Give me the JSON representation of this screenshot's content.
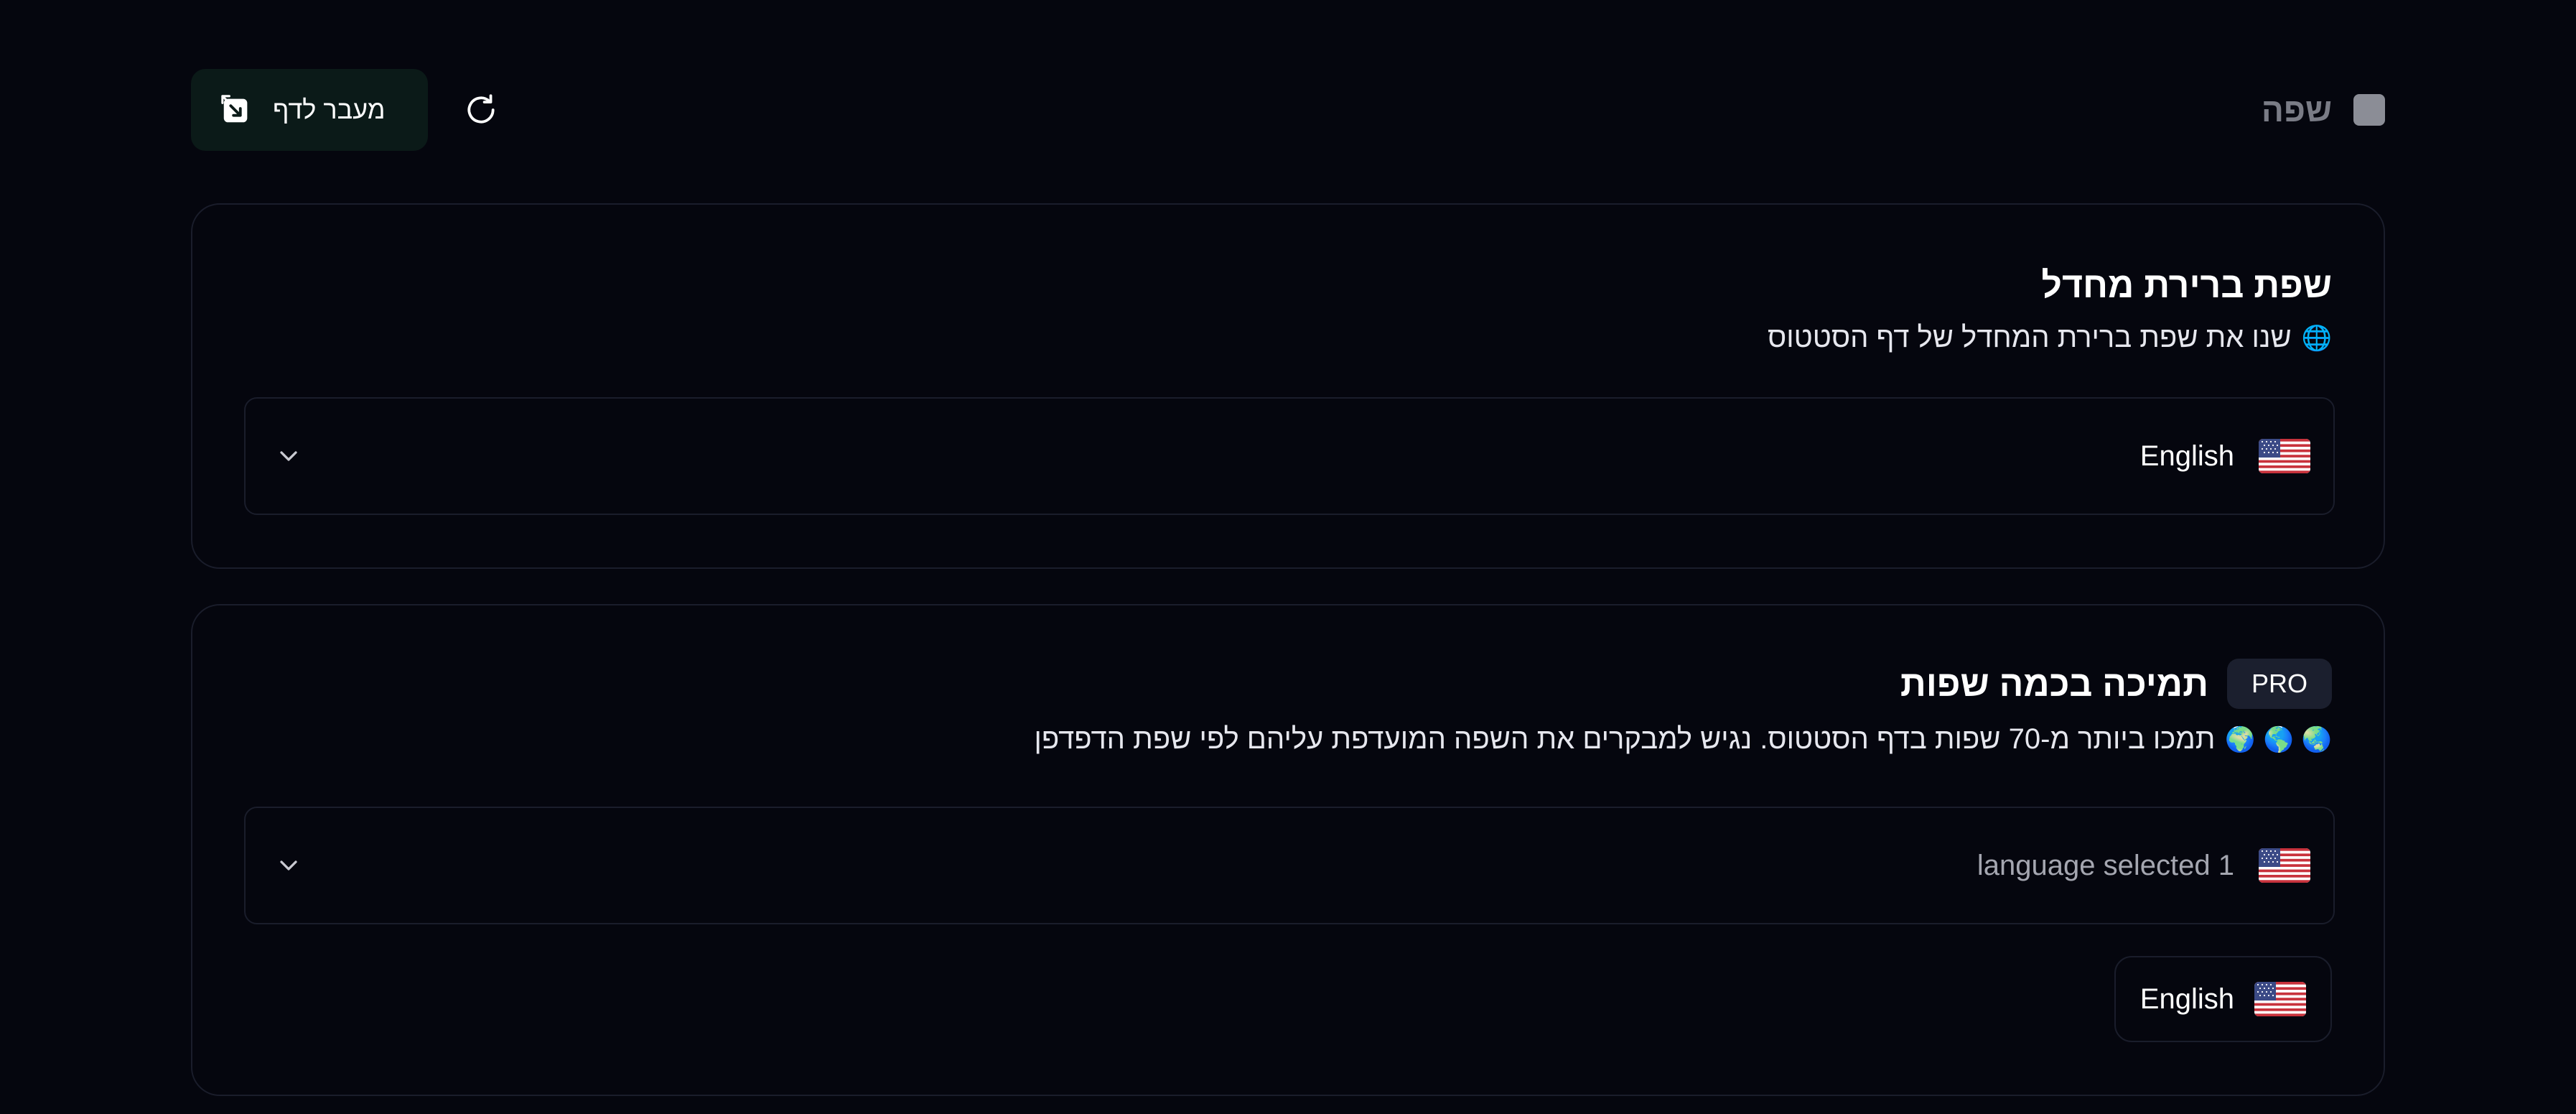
{
  "header": {
    "title": "שפה",
    "open_page_label": "מעבר לדף",
    "icons": {
      "title_icon": "square-icon",
      "open_icon": "external-link-icon",
      "refresh_icon": "refresh-icon"
    }
  },
  "default_language": {
    "title": "שפת ברירת מחדל",
    "description": "שנו את שפת ברירת המחדל של דף הסטטוס",
    "description_emoji": "🌐",
    "selected": "English",
    "selected_flag": "us-flag-icon"
  },
  "multi_language": {
    "title": "תמיכה בכמה שפות",
    "badge": "PRO",
    "description": "תמכו ביותר מ-70 שפות בדף הסטטוס. נגיש למבקרים את השפה המועדפת עליהם לפי שפת הדפדפן",
    "description_emoji": "🌍 🌎 🌏",
    "select_summary": "language selected 1",
    "chips": [
      {
        "label": "English",
        "flag": "us-flag-icon"
      }
    ]
  },
  "colors": {
    "background": "#05060e",
    "card_border": "#1a1d2b",
    "button_bg": "#0b1a18",
    "badge_bg": "#1b1f2e"
  }
}
